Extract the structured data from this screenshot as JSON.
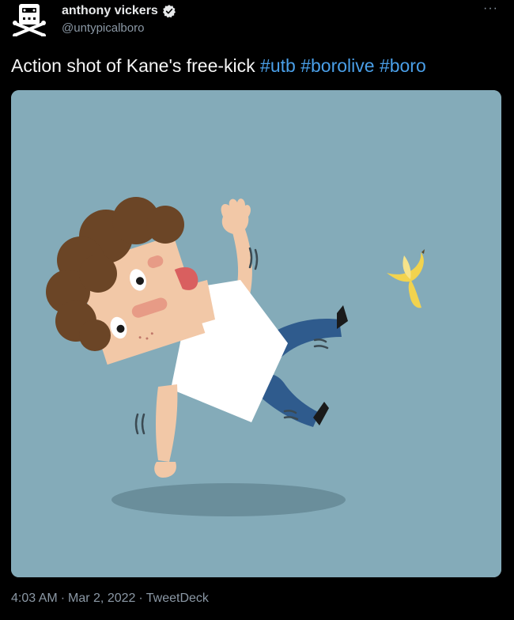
{
  "author": {
    "display_name": "anthony vickers",
    "handle": "@untypicalboro",
    "verified": true
  },
  "tweet": {
    "text": "Action shot of Kane's free-kick",
    "hashtags": [
      "#utb",
      "#borolive",
      "#boro"
    ],
    "time": "4:03 AM",
    "date": "Mar 2, 2022",
    "separator": "·",
    "source": "TweetDeck"
  },
  "menu": {
    "more_label": "···"
  },
  "icons": {
    "avatar": "cassette-skull-crossbones-icon",
    "verified": "verified-badge-icon",
    "more": "more-options-icon"
  },
  "colors": {
    "background": "#000000",
    "text": "#e7e9ea",
    "secondary": "#8b98a5",
    "hashtag": "#4a9fe8",
    "media_background": "#84abb9"
  }
}
